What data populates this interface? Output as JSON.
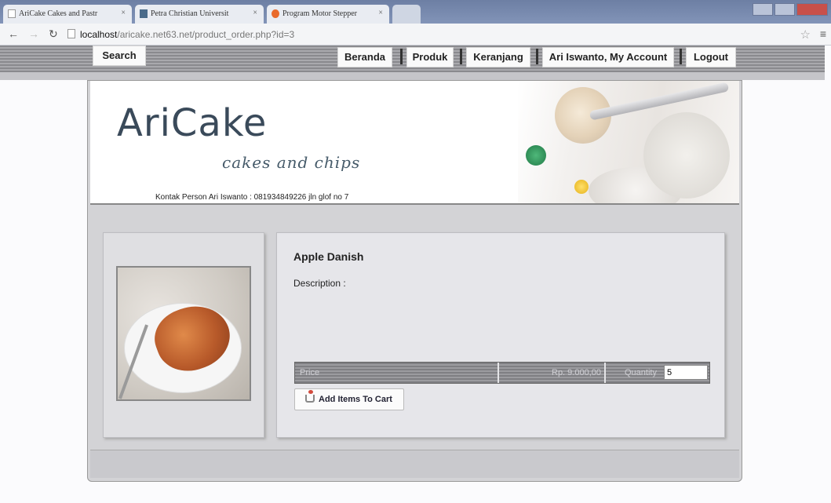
{
  "browser": {
    "tabs": [
      {
        "title": "AriCake Cakes and Pastr"
      },
      {
        "title": "Petra Christian Universit"
      },
      {
        "title": "Program Motor Stepper"
      }
    ],
    "url_host": "localhost",
    "url_path": "/aricake.net63.net/product_order.php?id=3"
  },
  "nav": {
    "search_label": "Search",
    "items": [
      {
        "label": "Beranda"
      },
      {
        "label": "Produk"
      },
      {
        "label": "Keranjang"
      },
      {
        "label": "Ari Iswanto, My Account"
      },
      {
        "label": "Logout"
      }
    ]
  },
  "header": {
    "logo": "AriCake",
    "tagline": "cakes and chips",
    "contact": "Kontak Person Ari Iswanto : 081934849226 jln glof no 7"
  },
  "product": {
    "name": "Apple Danish",
    "description_label": "Description :",
    "price_label": "Price",
    "price_value": "Rp. 9.000,00",
    "quantity_label": "Quantity",
    "quantity_value": "5",
    "add_button": "Add Items To Cart"
  }
}
